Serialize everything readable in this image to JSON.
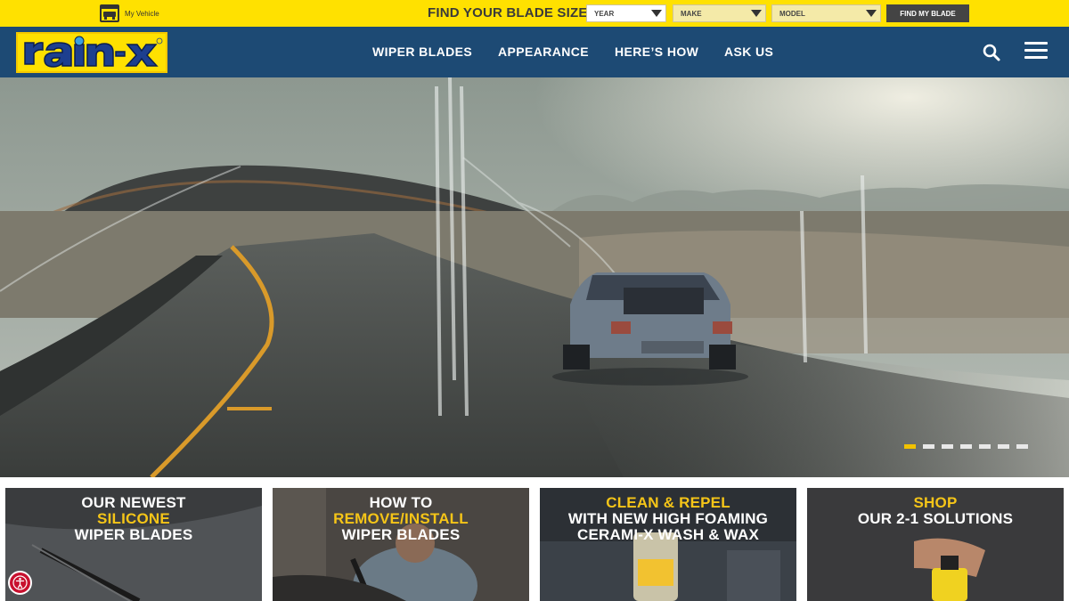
{
  "topbar": {
    "my_vehicle_label": "My Vehicle",
    "find_label": "FIND YOUR BLADE SIZE:",
    "year_value": "YEAR",
    "make_value": "MAKE",
    "model_value": "MODEL",
    "find_button": "FIND MY BLADE"
  },
  "nav": {
    "logo_alt": "rain-x",
    "items": [
      {
        "label": "WIPER BLADES"
      },
      {
        "label": "APPEARANCE"
      },
      {
        "label": "HERE’S HOW"
      },
      {
        "label": "ASK US"
      }
    ]
  },
  "hero": {
    "slide_count": 7,
    "active_slide": 1
  },
  "cards": [
    {
      "line1": "OUR NEWEST",
      "line2": "SILICONE",
      "line3": "WIPER BLADES"
    },
    {
      "line1": "HOW TO",
      "line2": "REMOVE/INSTALL",
      "line3": "WIPER BLADES"
    },
    {
      "line1": "CLEAN & REPEL",
      "line2": "WITH NEW HIGH FOAMING",
      "line3": "CERAMI-X WASH & WAX"
    },
    {
      "line1": "SHOP",
      "line2": "OUR 2-1 SOLUTIONS"
    }
  ],
  "colors": {
    "topbar": "#ffe100",
    "navbar": "#1d4a74",
    "accent_yellow": "#f5c518",
    "button_dark": "#444444",
    "accessibility_red": "#c8102e"
  },
  "icons": [
    "vehicle-icon",
    "search-icon",
    "menu-icon",
    "accessibility-icon"
  ]
}
